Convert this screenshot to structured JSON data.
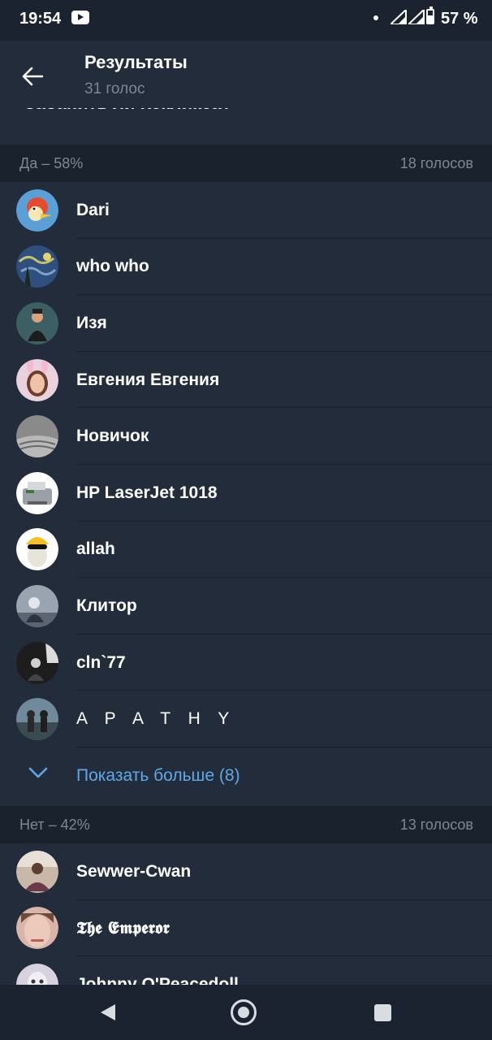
{
  "status_bar": {
    "time": "19:54",
    "battery": "57 %",
    "icons": [
      "youtube-icon",
      "dot-icon",
      "signal-icon",
      "signal-icon",
      "battery-icon"
    ]
  },
  "header": {
    "title": "Результаты",
    "subtitle": "31 голос",
    "question": "Забанить ли Кекликса?"
  },
  "options": [
    {
      "label": "Да – 58%",
      "votes": "18 голосов",
      "voters": [
        "Dari",
        "who who",
        "Изя",
        "Евгения Евгения",
        "Новичок",
        "HP LaserJet 1018",
        "allah",
        "Клитор",
        "cln`77",
        "A P A T H Y"
      ],
      "show_more": "Показать больше (8)"
    },
    {
      "label": "Нет – 42%",
      "votes": "13 голосов",
      "voters": [
        "Sewwer-Cwan",
        "𝕿𝖍𝖊 𝕰𝖒𝖕𝖊𝖗𝖔𝖗",
        "Johnny O'Peacedoll"
      ]
    }
  ],
  "colors": {
    "background": "#222c3a",
    "section_bar": "#1a222e",
    "accent": "#5fa9e8",
    "muted_text": "#7d8893"
  }
}
